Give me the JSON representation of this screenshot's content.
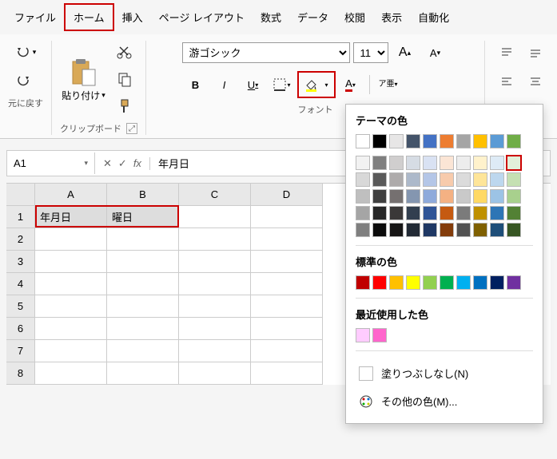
{
  "menu": {
    "items": [
      "ファイル",
      "ホーム",
      "挿入",
      "ページ レイアウト",
      "数式",
      "データ",
      "校閲",
      "表示",
      "自動化"
    ],
    "active_index": 1
  },
  "ribbon": {
    "undo_group": "元に戻す",
    "clipboard_group": "クリップボード",
    "paste_label": "貼り付け",
    "font_group": "フォント",
    "font_name": "游ゴシック",
    "font_size": "11",
    "bold": "B",
    "italic": "I",
    "underline": "U",
    "phonetic": "ア亜"
  },
  "namebox": "A1",
  "formula_value": "年月日",
  "grid": {
    "columns": [
      "A",
      "B",
      "C",
      "D"
    ],
    "rows": [
      "1",
      "2",
      "3",
      "4",
      "5",
      "6",
      "7",
      "8"
    ],
    "a1": "年月日",
    "b1": "曜日"
  },
  "popup": {
    "theme_title": "テーマの色",
    "standard_title": "標準の色",
    "recent_title": "最近使用した色",
    "no_fill": "塗りつぶしなし(N)",
    "more_colors": "その他の色(M)...",
    "theme_row": [
      "#ffffff",
      "#000000",
      "#e7e6e6",
      "#44546a",
      "#4472c4",
      "#ed7d31",
      "#a5a5a5",
      "#ffc000",
      "#5b9bd5",
      "#70ad47"
    ],
    "theme_shades": [
      [
        "#f2f2f2",
        "#7f7f7f",
        "#d0cece",
        "#d6dce4",
        "#d9e2f3",
        "#fbe5d5",
        "#ededed",
        "#fff2cc",
        "#deebf6",
        "#e2efd9"
      ],
      [
        "#d8d8d8",
        "#595959",
        "#aeabab",
        "#adb9ca",
        "#b4c6e7",
        "#f7cbac",
        "#dbdbdb",
        "#fee599",
        "#bdd7ee",
        "#c5e0b3"
      ],
      [
        "#bfbfbf",
        "#3f3f3f",
        "#757070",
        "#8496b0",
        "#8eaadb",
        "#f4b183",
        "#c9c9c9",
        "#ffd965",
        "#9cc3e5",
        "#a8d08d"
      ],
      [
        "#a5a5a5",
        "#262626",
        "#3a3838",
        "#323f4f",
        "#2f5496",
        "#c55a11",
        "#7b7b7b",
        "#bf9000",
        "#2e75b5",
        "#538135"
      ],
      [
        "#7f7f7f",
        "#0c0c0c",
        "#171616",
        "#222a35",
        "#1f3864",
        "#833c0b",
        "#525252",
        "#7f6000",
        "#1e4e79",
        "#375623"
      ]
    ],
    "standard_row": [
      "#c00000",
      "#ff0000",
      "#ffc000",
      "#ffff00",
      "#92d050",
      "#00b050",
      "#00b0f0",
      "#0070c0",
      "#002060",
      "#7030a0"
    ],
    "recent_row": [
      "#ffccff",
      "#ff66cc"
    ],
    "selected_shade": {
      "row": 0,
      "col": 9
    }
  }
}
